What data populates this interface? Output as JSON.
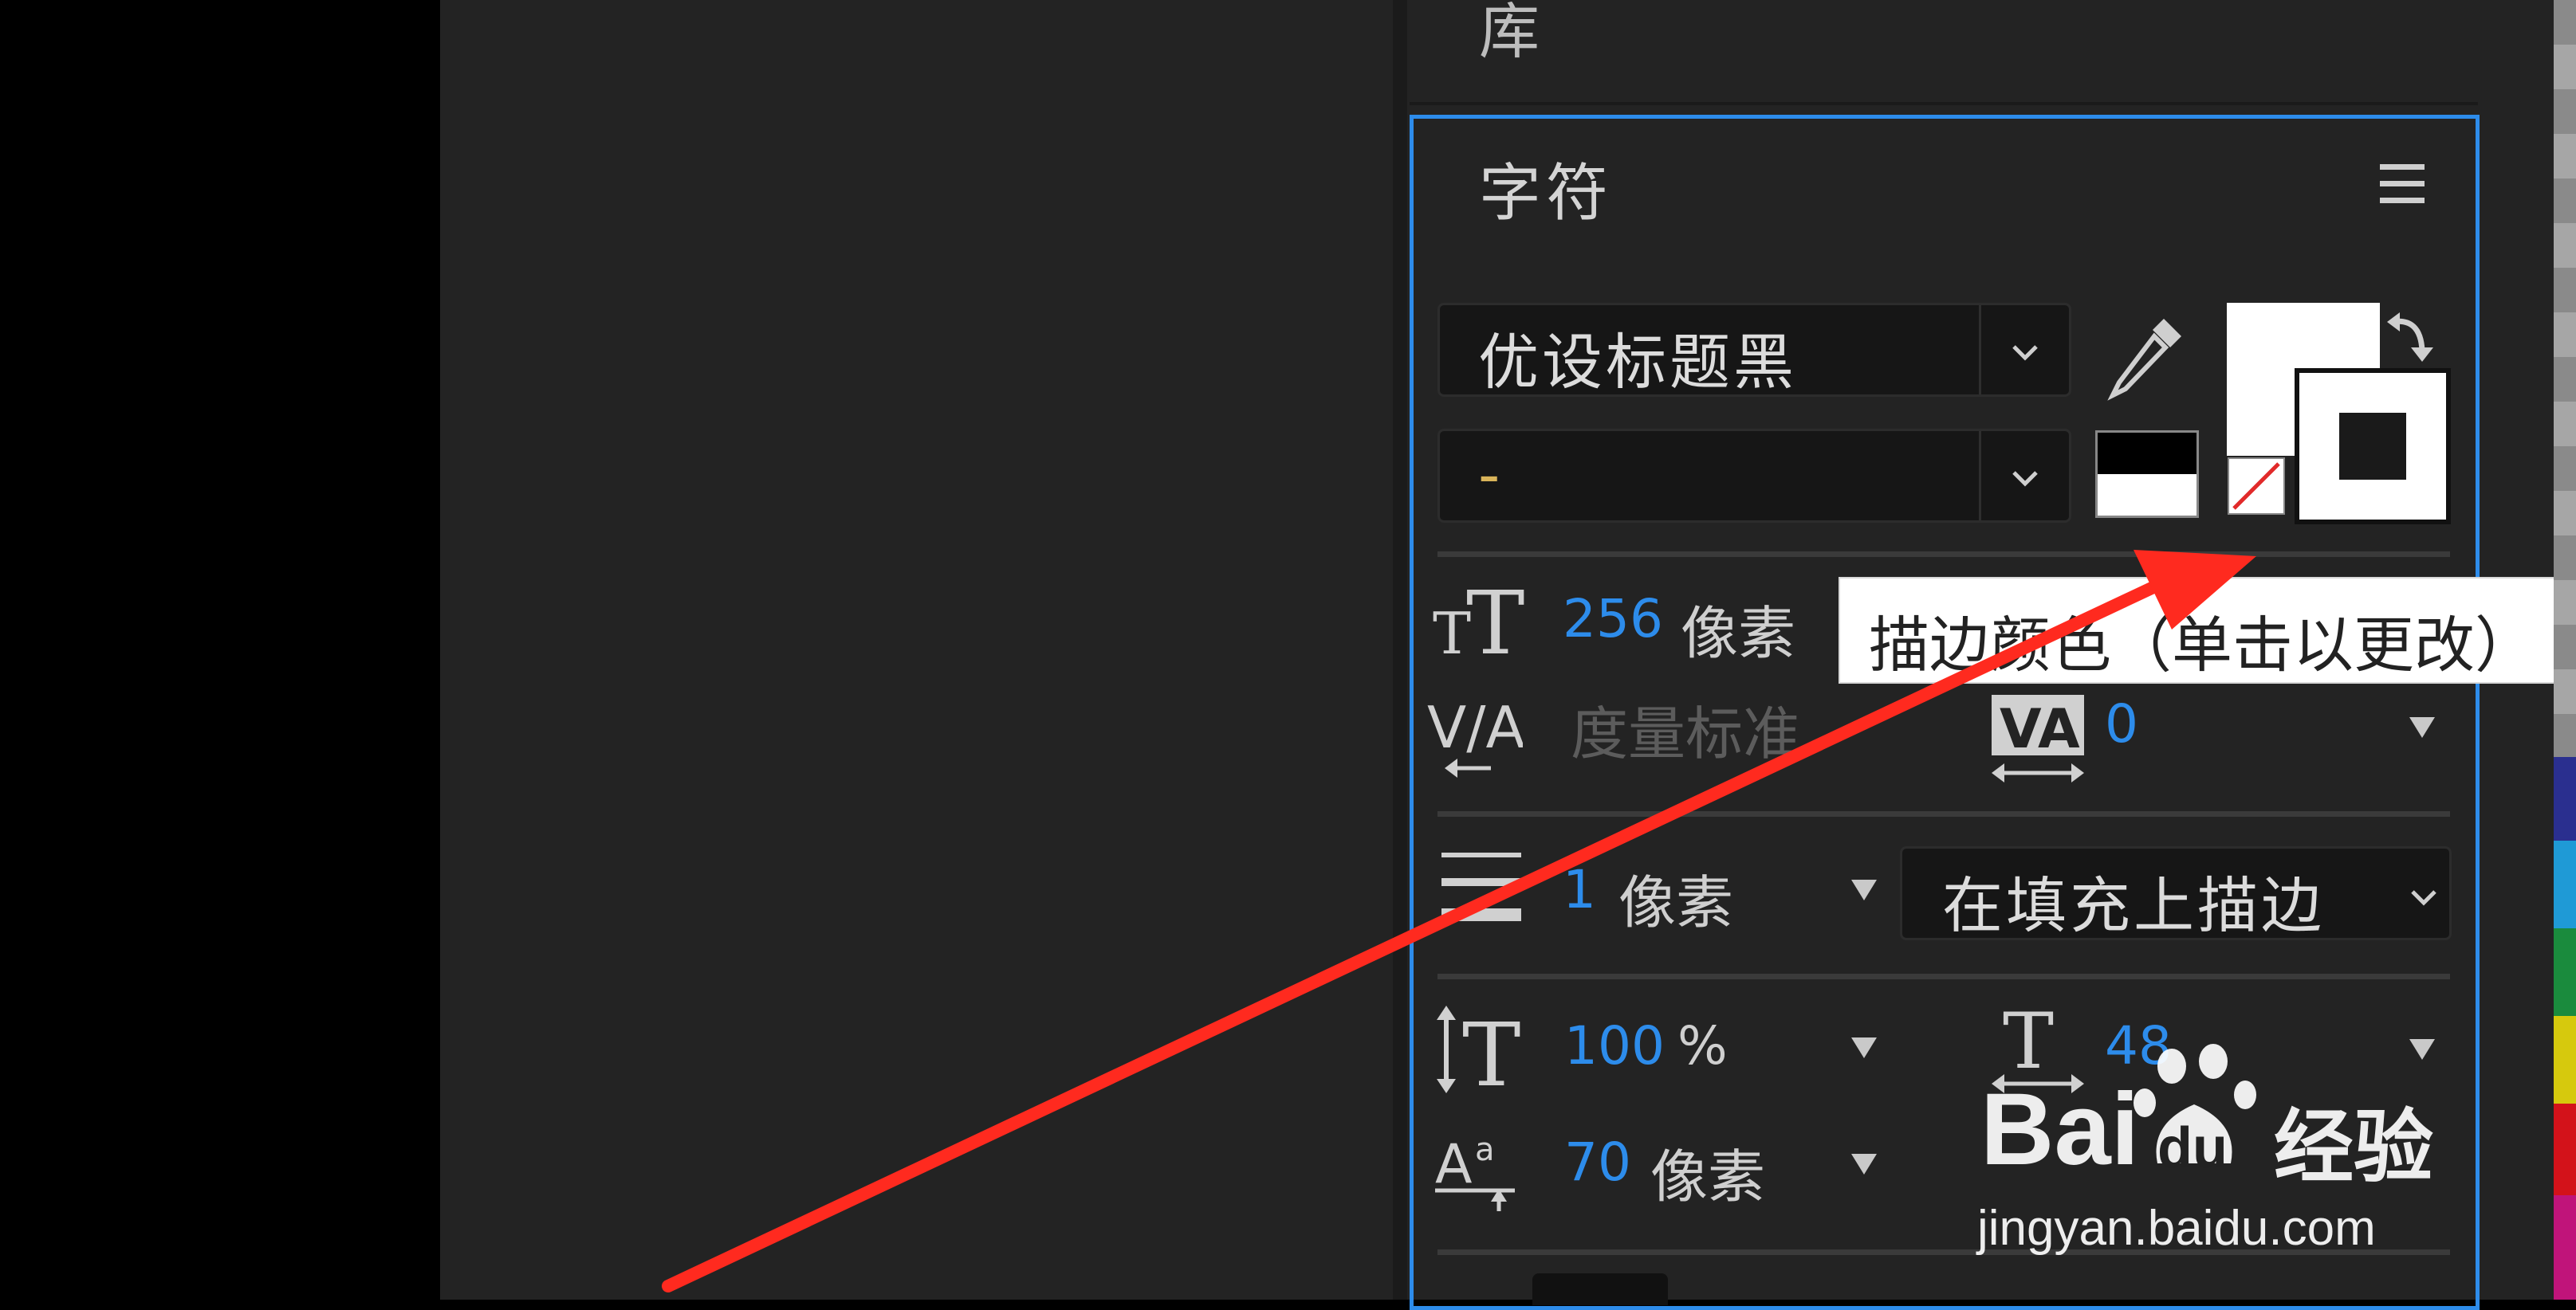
{
  "library": {
    "title": "库"
  },
  "character_panel": {
    "title": "字符",
    "font_family": {
      "value": "优设标题黑"
    },
    "font_style": {
      "value": "-"
    },
    "font_size": {
      "value": "256",
      "unit": "像素"
    },
    "kerning": {
      "value": "度量标准"
    },
    "tracking": {
      "value": "0"
    },
    "stroke_width": {
      "value": "1",
      "unit": "像素"
    },
    "stroke_mode": {
      "value": "在填充上描边"
    },
    "vertical_scale": {
      "value": "100",
      "unit": "%"
    },
    "horizontal_scale": {
      "value": "48"
    },
    "baseline_shift": {
      "value": "70",
      "unit": "像素"
    }
  },
  "tooltip": {
    "text": "描边颜色（单击以更改）"
  },
  "watermark": {
    "brand": "Bai",
    "brand2": "du",
    "cn": "经验",
    "url": "jingyan.baidu.com"
  },
  "colors": {
    "accent": "#2d8ceb",
    "panel_bg": "#232323",
    "arrow": "#ff2a1f",
    "fill_swatch": "#ffffff",
    "stroke_swatch": "#ffffff"
  }
}
